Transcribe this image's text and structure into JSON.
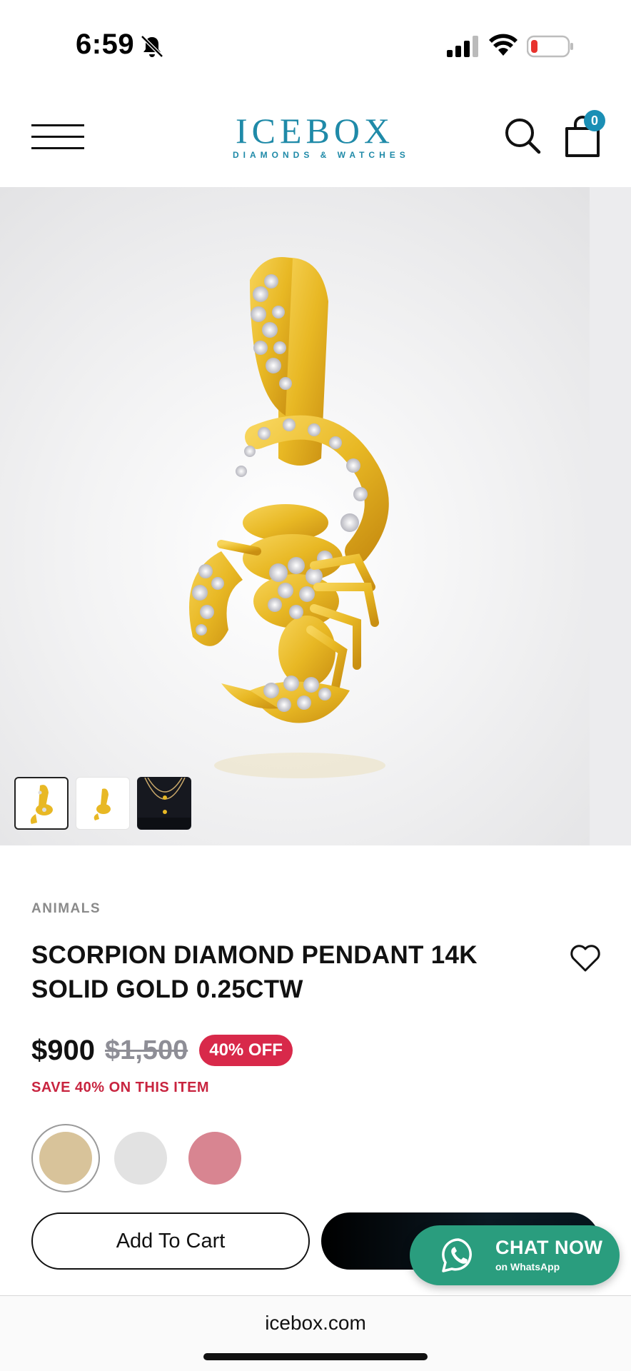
{
  "status_bar": {
    "time": "6:59",
    "icons": [
      "bell-slash-icon",
      "cellular-signal-icon",
      "wifi-icon",
      "battery-low-icon"
    ],
    "battery_color": "#e8332e"
  },
  "header": {
    "brand_name": "ICEBOX",
    "brand_tagline": "DIAMONDS & WATCHES",
    "cart_count": "0",
    "brand_color": "#1f8aa8",
    "icons": [
      "menu-icon",
      "search-icon",
      "shopping-bag-icon"
    ]
  },
  "gallery": {
    "thumbnails": [
      "pendant-thumbnail",
      "pendant-angle-thumbnail",
      "worn-on-model-thumbnail"
    ],
    "active_index": 0
  },
  "product": {
    "category": "ANIMALS",
    "title": "SCORPION DIAMOND PENDANT 14K SOLID GOLD 0.25CTW",
    "price": "$900",
    "original_price": "$1,500",
    "discount_badge": "40% OFF",
    "savings_text": "SAVE 40% ON THIS ITEM",
    "accent_color": "#d8294a",
    "metal_swatches": [
      {
        "name": "yellow-gold",
        "color": "#d8c39a",
        "selected": true
      },
      {
        "name": "white-gold",
        "color": "#e2e2e2",
        "selected": false
      },
      {
        "name": "rose-gold",
        "color": "#d88591",
        "selected": false
      }
    ]
  },
  "actions": {
    "add_to_cart": "Add To Cart",
    "chat_now": "CHAT NOW",
    "chat_sub": "on WhatsApp",
    "chat_color": "#2a9d7e"
  },
  "browser": {
    "url": "icebox.com"
  }
}
